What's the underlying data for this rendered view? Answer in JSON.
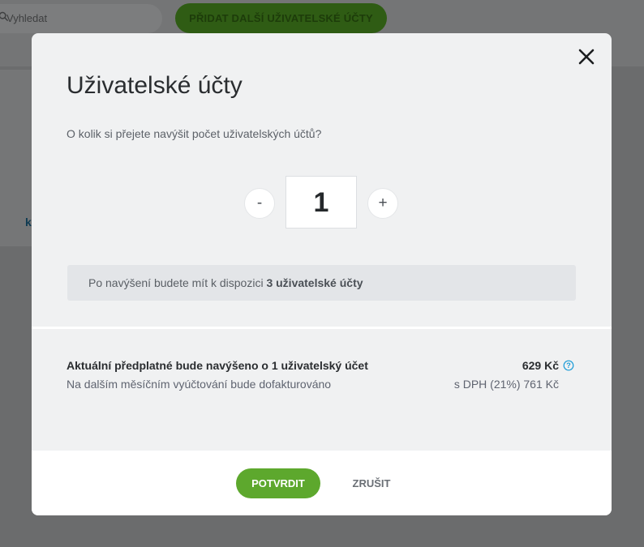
{
  "background": {
    "search_placeholder": "Vyhledat",
    "add_button_label": "PŘIDAT DALŠÍ UŽIVATELSKÉ ÚČTY",
    "card_letter": "k"
  },
  "modal": {
    "title": "Uživatelské účty",
    "question": "O kolik si přejete navýšit počet uživatelských účtů?",
    "stepper": {
      "minus_label": "-",
      "value": "1",
      "plus_label": "+"
    },
    "info": {
      "prefix": "Po navýšení budete mít k dispozici ",
      "highlight": "3 uživatelské účty"
    },
    "summary": {
      "title": "Aktuální předplatné bude navýšeno o 1 uživatelský účet",
      "price": "629 Kč",
      "subtitle": "Na dalším měsíčním vyúčtování bude dofakturováno",
      "vat": "s DPH (21%) 761 Kč"
    },
    "footer": {
      "confirm_label": "POTVRDIT",
      "cancel_label": "ZRUŠIT"
    }
  },
  "icons": {
    "close": "close-icon",
    "help": "help-icon",
    "search": "search-icon"
  },
  "colors": {
    "accent_green": "#5da82d",
    "help_blue": "#1a9bd7",
    "overlay": "#6b6c6d"
  }
}
